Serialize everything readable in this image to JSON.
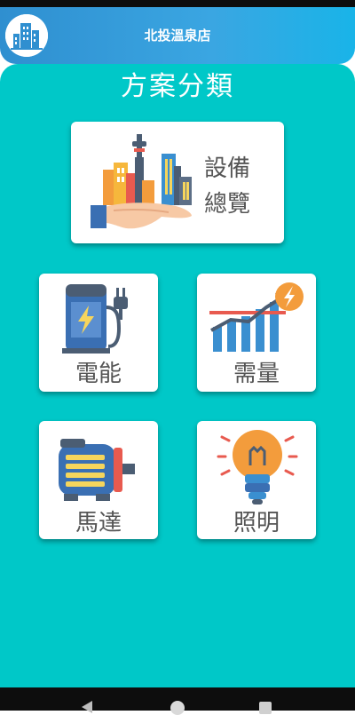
{
  "header": {
    "title": "北投溫泉店",
    "logo_icon": "building-icon"
  },
  "main": {
    "title": "方案分類",
    "background_color": "#00c8c8"
  },
  "cards": {
    "overview": {
      "label_line1": "設備",
      "label_line2": "總覽",
      "icon": "city-in-hand-icon"
    },
    "electric": {
      "label": "電能",
      "icon": "ev-charger-icon"
    },
    "demand": {
      "label": "需量",
      "icon": "demand-chart-icon"
    },
    "motor": {
      "label": "馬達",
      "icon": "motor-icon"
    },
    "lighting": {
      "label": "照明",
      "icon": "light-bulb-icon"
    }
  },
  "navbar": {
    "back_icon": "back-triangle-icon",
    "home_icon": "home-circle-icon",
    "recent_icon": "recent-square-icon"
  }
}
